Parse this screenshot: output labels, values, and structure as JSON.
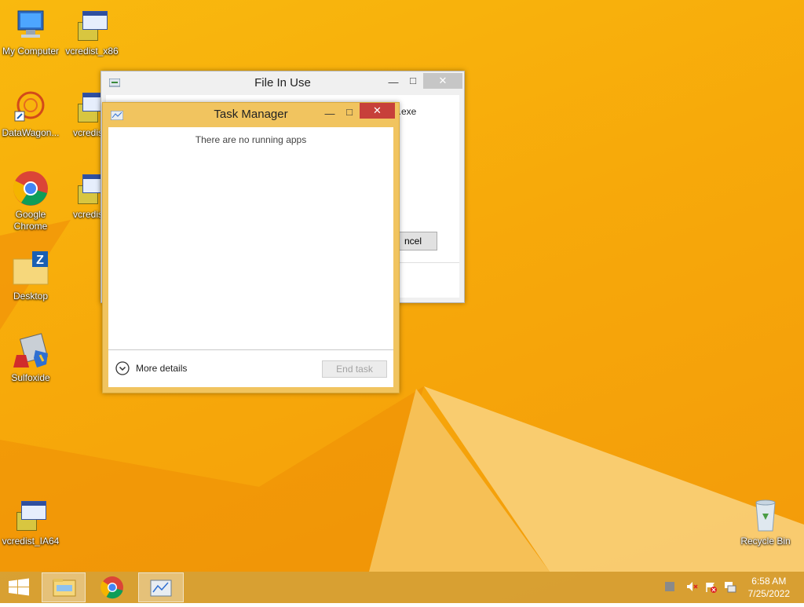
{
  "desktop": {
    "icons": [
      {
        "label": "My Computer",
        "icon": "computer-icon"
      },
      {
        "label": "vcredist_x86",
        "icon": "installer-icon"
      },
      {
        "label": "DataWagon...",
        "icon": "datawagon-icon"
      },
      {
        "label": "vcredist_",
        "icon": "installer-icon"
      },
      {
        "label": "Google Chrome",
        "icon": "chrome-icon"
      },
      {
        "label": "vcredist_",
        "icon": "installer-icon"
      },
      {
        "label": "Desktop",
        "icon": "folder-icon"
      },
      {
        "label": "Sulfoxide",
        "icon": "sulfoxide-icon"
      },
      {
        "label": "vcredist_IA64",
        "icon": "installer-icon"
      },
      {
        "label": "Recycle Bin",
        "icon": "recycle-bin-icon"
      }
    ]
  },
  "file_in_use": {
    "title": "File In Use",
    "visible_text": "e.exe",
    "cancel_partial": "ncel"
  },
  "task_manager": {
    "title": "Task Manager",
    "empty_message": "There are no running apps",
    "more_details": "More details",
    "end_task": "End task"
  },
  "taskbar": {
    "time": "6:58 AM",
    "date": "7/25/2022",
    "items": [
      "start-button",
      "file-explorer",
      "google-chrome",
      "task-manager"
    ]
  },
  "colors": {
    "accent": "#f1c45f",
    "close_red": "#c7403a",
    "desktop_bg": "#f7a90a"
  }
}
